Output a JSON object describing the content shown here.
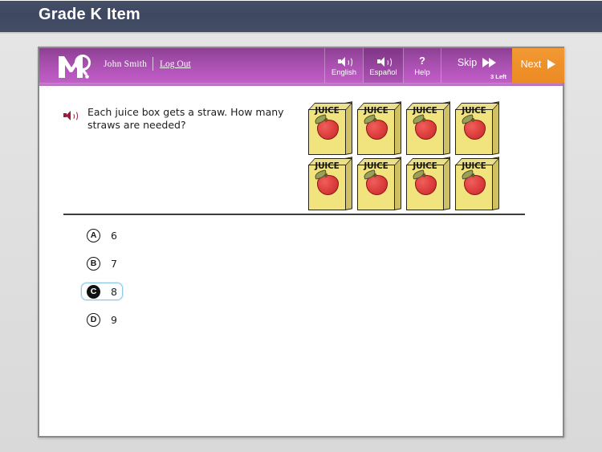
{
  "header": {
    "title": "Grade K Item"
  },
  "toolbar": {
    "logo_icon": "m-magnifier-logo",
    "user_name": "John Smith",
    "logout_label": "Log Out",
    "buttons": [
      {
        "id": "english",
        "label": "English",
        "icon": "speaker-icon",
        "selected": false
      },
      {
        "id": "espanol",
        "label": "Español",
        "icon": "speaker-icon",
        "selected": true
      },
      {
        "id": "help",
        "label": "Help",
        "icon": "question-mark-icon",
        "selected": false
      }
    ],
    "skip": {
      "label": "Skip",
      "sub_label": "3 Left",
      "icon": "double-chevron-right-icon"
    },
    "next": {
      "label": "Next",
      "icon": "play-triangle-icon"
    },
    "colors": {
      "toolbar_purple_top": "#8d3f93",
      "toolbar_purple_bottom": "#c064c6",
      "selected_tab_purple": "#8f4096",
      "next_orange": "#ee8f29"
    }
  },
  "question": {
    "speaker_icon": "speaker-icon",
    "text": "Each juice box gets a straw. How many straws are needed?"
  },
  "stimulus": {
    "item_label": "JUICE",
    "item_icon": "juice-box-with-apple",
    "count": 8,
    "columns": 4,
    "rows": 2
  },
  "options": [
    {
      "letter": "A",
      "value": "6",
      "selected": false
    },
    {
      "letter": "B",
      "value": "7",
      "selected": false
    },
    {
      "letter": "C",
      "value": "8",
      "selected": true
    },
    {
      "letter": "D",
      "value": "9",
      "selected": false
    }
  ],
  "colors": {
    "header_slate": "#414b63",
    "page_gray": "#e0e0e0",
    "speaker_maroon": "#9c1b3d",
    "selected_outline_blue": "#8fcbe8"
  }
}
